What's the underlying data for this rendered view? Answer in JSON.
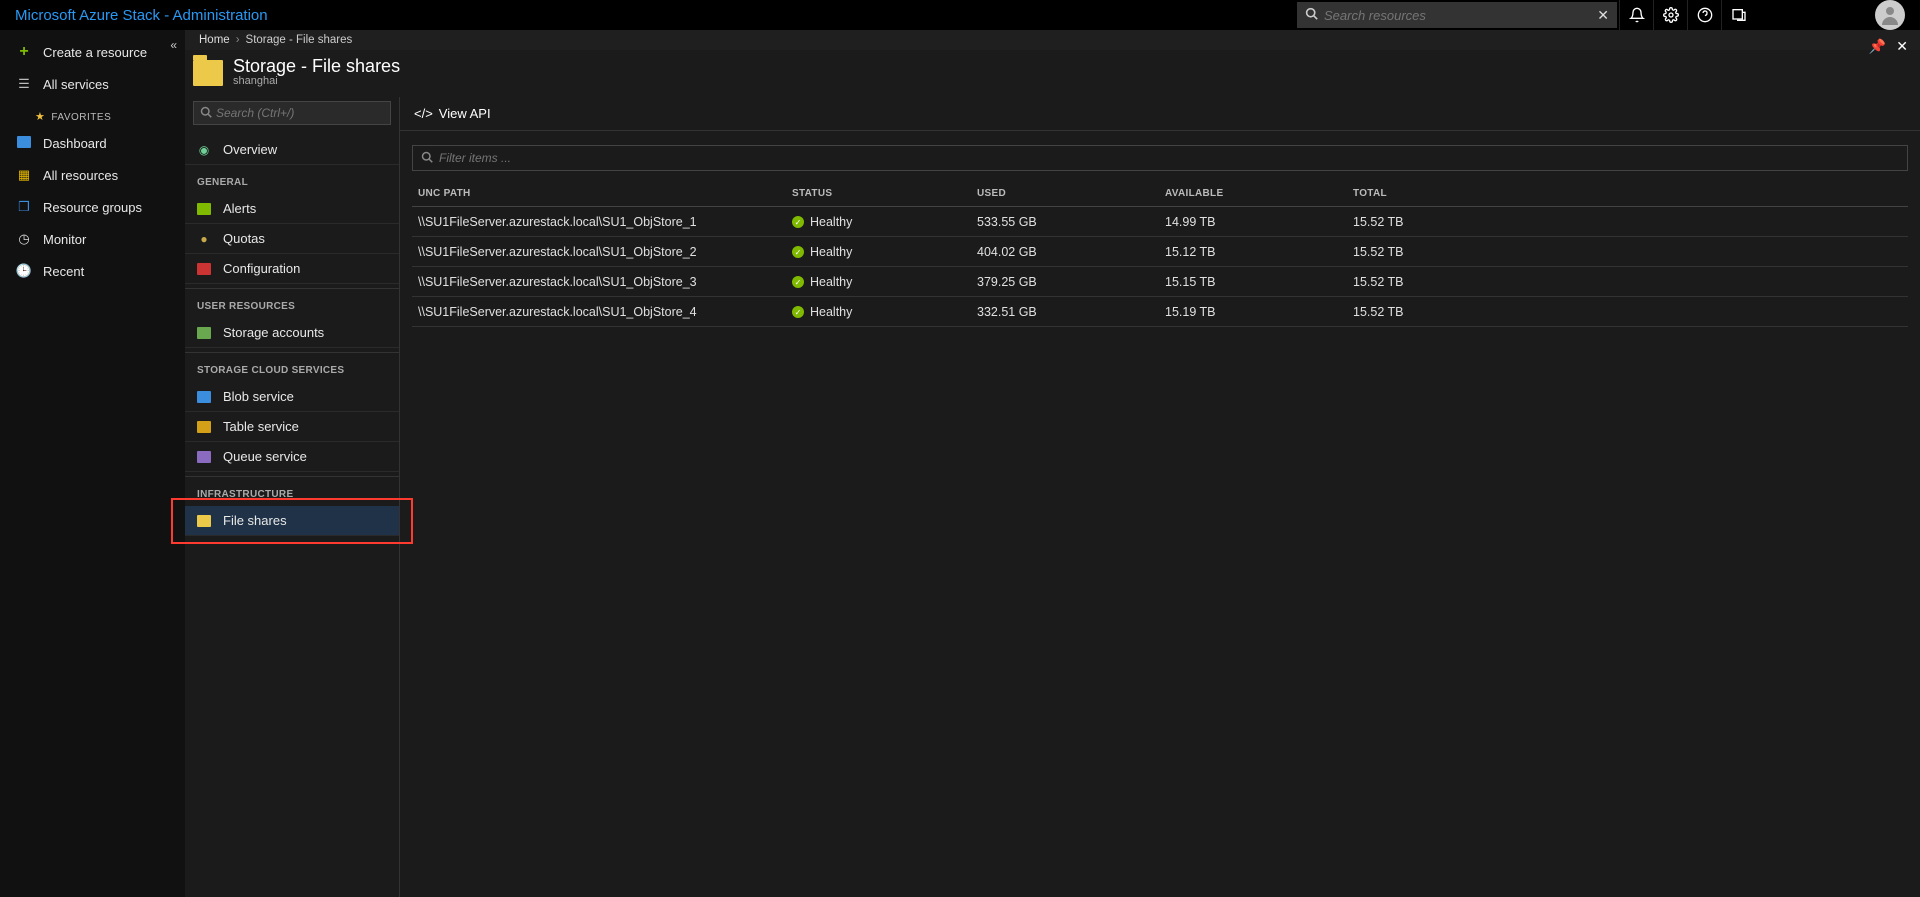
{
  "top": {
    "title": "Microsoft Azure Stack - Administration",
    "search_placeholder": "Search resources"
  },
  "left_nav": {
    "create": "Create a resource",
    "all_services": "All services",
    "favorites_label": "FAVORITES",
    "items": [
      "Dashboard",
      "All resources",
      "Resource groups",
      "Monitor",
      "Recent"
    ]
  },
  "breadcrumb": {
    "home": "Home",
    "current": "Storage - File shares"
  },
  "blade": {
    "title": "Storage - File shares",
    "subtitle": "shanghai",
    "search_placeholder": "Search (Ctrl+/)",
    "menu": {
      "overview": "Overview",
      "sections": [
        {
          "label": "GENERAL",
          "items": [
            "Alerts",
            "Quotas",
            "Configuration"
          ]
        },
        {
          "label": "USER RESOURCES",
          "items": [
            "Storage accounts"
          ]
        },
        {
          "label": "STORAGE CLOUD SERVICES",
          "items": [
            "Blob service",
            "Table service",
            "Queue service"
          ]
        },
        {
          "label": "INFRASTRUCTURE",
          "items": [
            "File shares"
          ]
        }
      ]
    }
  },
  "toolbar": {
    "view_api": "View API"
  },
  "filter_placeholder": "Filter items ...",
  "table": {
    "headers": {
      "unc": "UNC PATH",
      "status": "STATUS",
      "used": "USED",
      "available": "AVAILABLE",
      "total": "TOTAL"
    },
    "rows": [
      {
        "unc": "\\\\SU1FileServer.azurestack.local\\SU1_ObjStore_1",
        "status": "Healthy",
        "used": "533.55 GB",
        "available": "14.99 TB",
        "total": "15.52 TB"
      },
      {
        "unc": "\\\\SU1FileServer.azurestack.local\\SU1_ObjStore_2",
        "status": "Healthy",
        "used": "404.02 GB",
        "available": "15.12 TB",
        "total": "15.52 TB"
      },
      {
        "unc": "\\\\SU1FileServer.azurestack.local\\SU1_ObjStore_3",
        "status": "Healthy",
        "used": "379.25 GB",
        "available": "15.15 TB",
        "total": "15.52 TB"
      },
      {
        "unc": "\\\\SU1FileServer.azurestack.local\\SU1_ObjStore_4",
        "status": "Healthy",
        "used": "332.51 GB",
        "available": "15.19 TB",
        "total": "15.52 TB"
      }
    ]
  }
}
